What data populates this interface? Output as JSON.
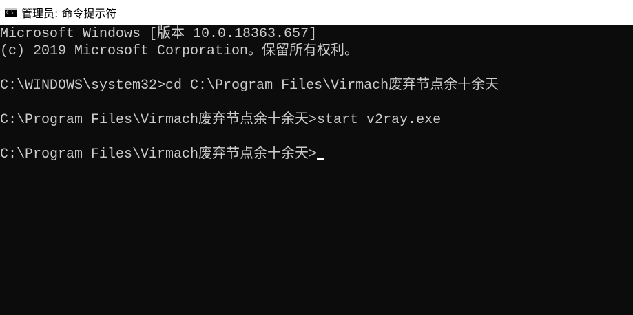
{
  "window": {
    "title": "管理员: 命令提示符",
    "icon": "command-prompt-icon",
    "icon_glyph": "C:\\",
    "colors": {
      "console_background": "#0c0c0c",
      "console_text": "#cccccc",
      "titlebar_background": "#ffffff"
    }
  },
  "console": {
    "lines": [
      "Microsoft Windows [版本 10.0.18363.657]",
      "(c) 2019 Microsoft Corporation。保留所有权利。",
      "",
      "C:\\WINDOWS\\system32>cd C:\\Program Files\\Virmach废弃节点余十余天",
      "",
      "C:\\Program Files\\Virmach废弃节点余十余天>start v2ray.exe",
      "",
      "C:\\Program Files\\Virmach废弃节点余十余天>"
    ]
  }
}
